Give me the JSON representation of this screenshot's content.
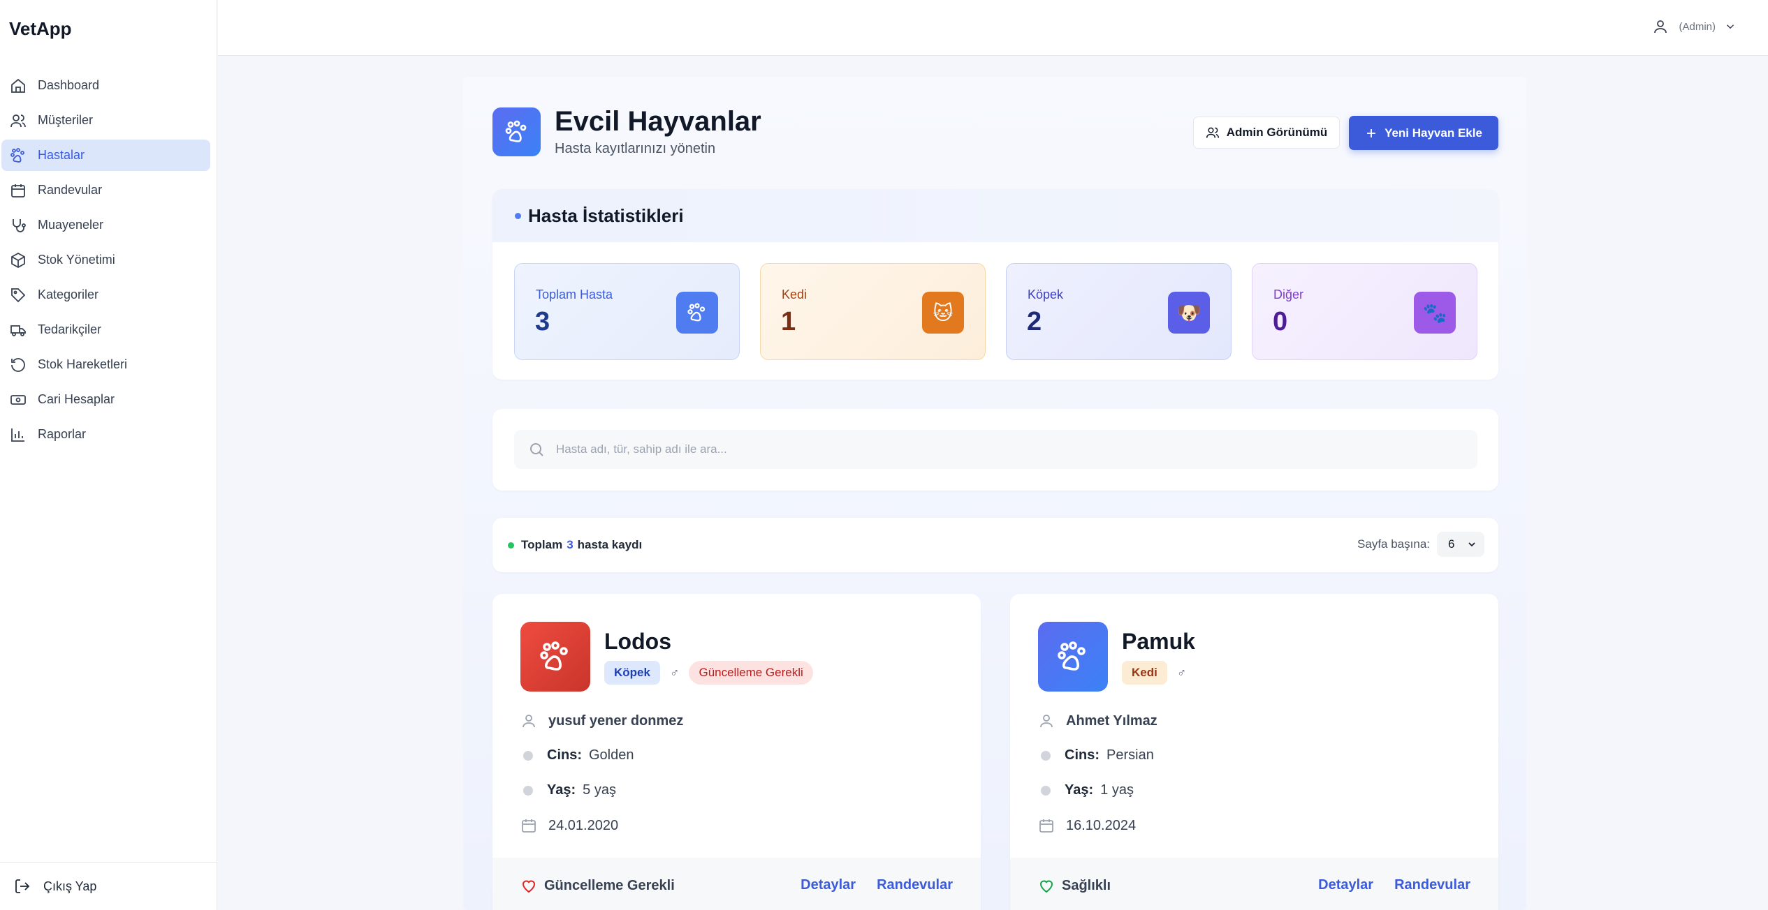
{
  "app": {
    "logo": "VetApp"
  },
  "sidebar": {
    "items": [
      {
        "label": "Dashboard",
        "icon": "home-icon"
      },
      {
        "label": "Müşteriler",
        "icon": "users-icon"
      },
      {
        "label": "Hastalar",
        "icon": "paw-icon",
        "active": true
      },
      {
        "label": "Randevular",
        "icon": "calendar-icon"
      },
      {
        "label": "Muayeneler",
        "icon": "stethoscope-icon"
      },
      {
        "label": "Stok Yönetimi",
        "icon": "box-icon"
      },
      {
        "label": "Kategoriler",
        "icon": "tag-icon"
      },
      {
        "label": "Tedarikçiler",
        "icon": "truck-icon"
      },
      {
        "label": "Stok Hareketleri",
        "icon": "history-icon"
      },
      {
        "label": "Cari Hesaplar",
        "icon": "money-icon"
      },
      {
        "label": "Raporlar",
        "icon": "bar-chart-icon"
      }
    ],
    "logout": "Çıkış Yap"
  },
  "topbar": {
    "user_label": "(Admin)"
  },
  "header": {
    "title": "Evcil Hayvanlar",
    "subtitle": "Hasta kayıtlarınızı yönetin",
    "admin_button": "Admin Görünümü",
    "new_button": "Yeni Hayvan Ekle"
  },
  "stats": {
    "title": "Hasta İstatistikleri",
    "boxes": [
      {
        "label": "Toplam Hasta",
        "value": "3",
        "icon": "paw-icon"
      },
      {
        "label": "Kedi",
        "value": "1",
        "icon": "🐱"
      },
      {
        "label": "Köpek",
        "value": "2",
        "icon": "🐶"
      },
      {
        "label": "Diğer",
        "value": "0",
        "icon": "🐾"
      }
    ],
    "colors": {
      "total": "#4f7cf0",
      "cat": "#e3791e",
      "dog": "#5b5ee6",
      "other": "#9d5ae8"
    }
  },
  "search": {
    "placeholder": "Hasta adı, tür, sahip adı ile ara...",
    "value": ""
  },
  "summary": {
    "prefix": "Toplam",
    "count": "3",
    "suffix": "hasta kaydı",
    "per_page_label": "Sayfa başına:",
    "per_page_value": "6"
  },
  "pets": [
    {
      "name": "Lodos",
      "species": "Köpek",
      "gender": "♂",
      "warning": "Güncelleme Gerekli",
      "owner": "yusuf yener donmez",
      "breed_label": "Cins:",
      "breed": "Golden",
      "age_label": "Yaş:",
      "age": "5 yaş",
      "date": "24.01.2020",
      "status": "Güncelleme Gerekli",
      "status_color": "#dc2626",
      "details": "Detaylar",
      "appointments": "Randevular"
    },
    {
      "name": "Pamuk",
      "species": "Kedi",
      "gender": "♂",
      "owner": "Ahmet Yılmaz",
      "breed_label": "Cins:",
      "breed": "Persian",
      "age_label": "Yaş:",
      "age": "1 yaş",
      "date": "16.10.2024",
      "status": "Sağlıklı",
      "status_color": "#16a34a",
      "details": "Detaylar",
      "appointments": "Randevular"
    }
  ]
}
